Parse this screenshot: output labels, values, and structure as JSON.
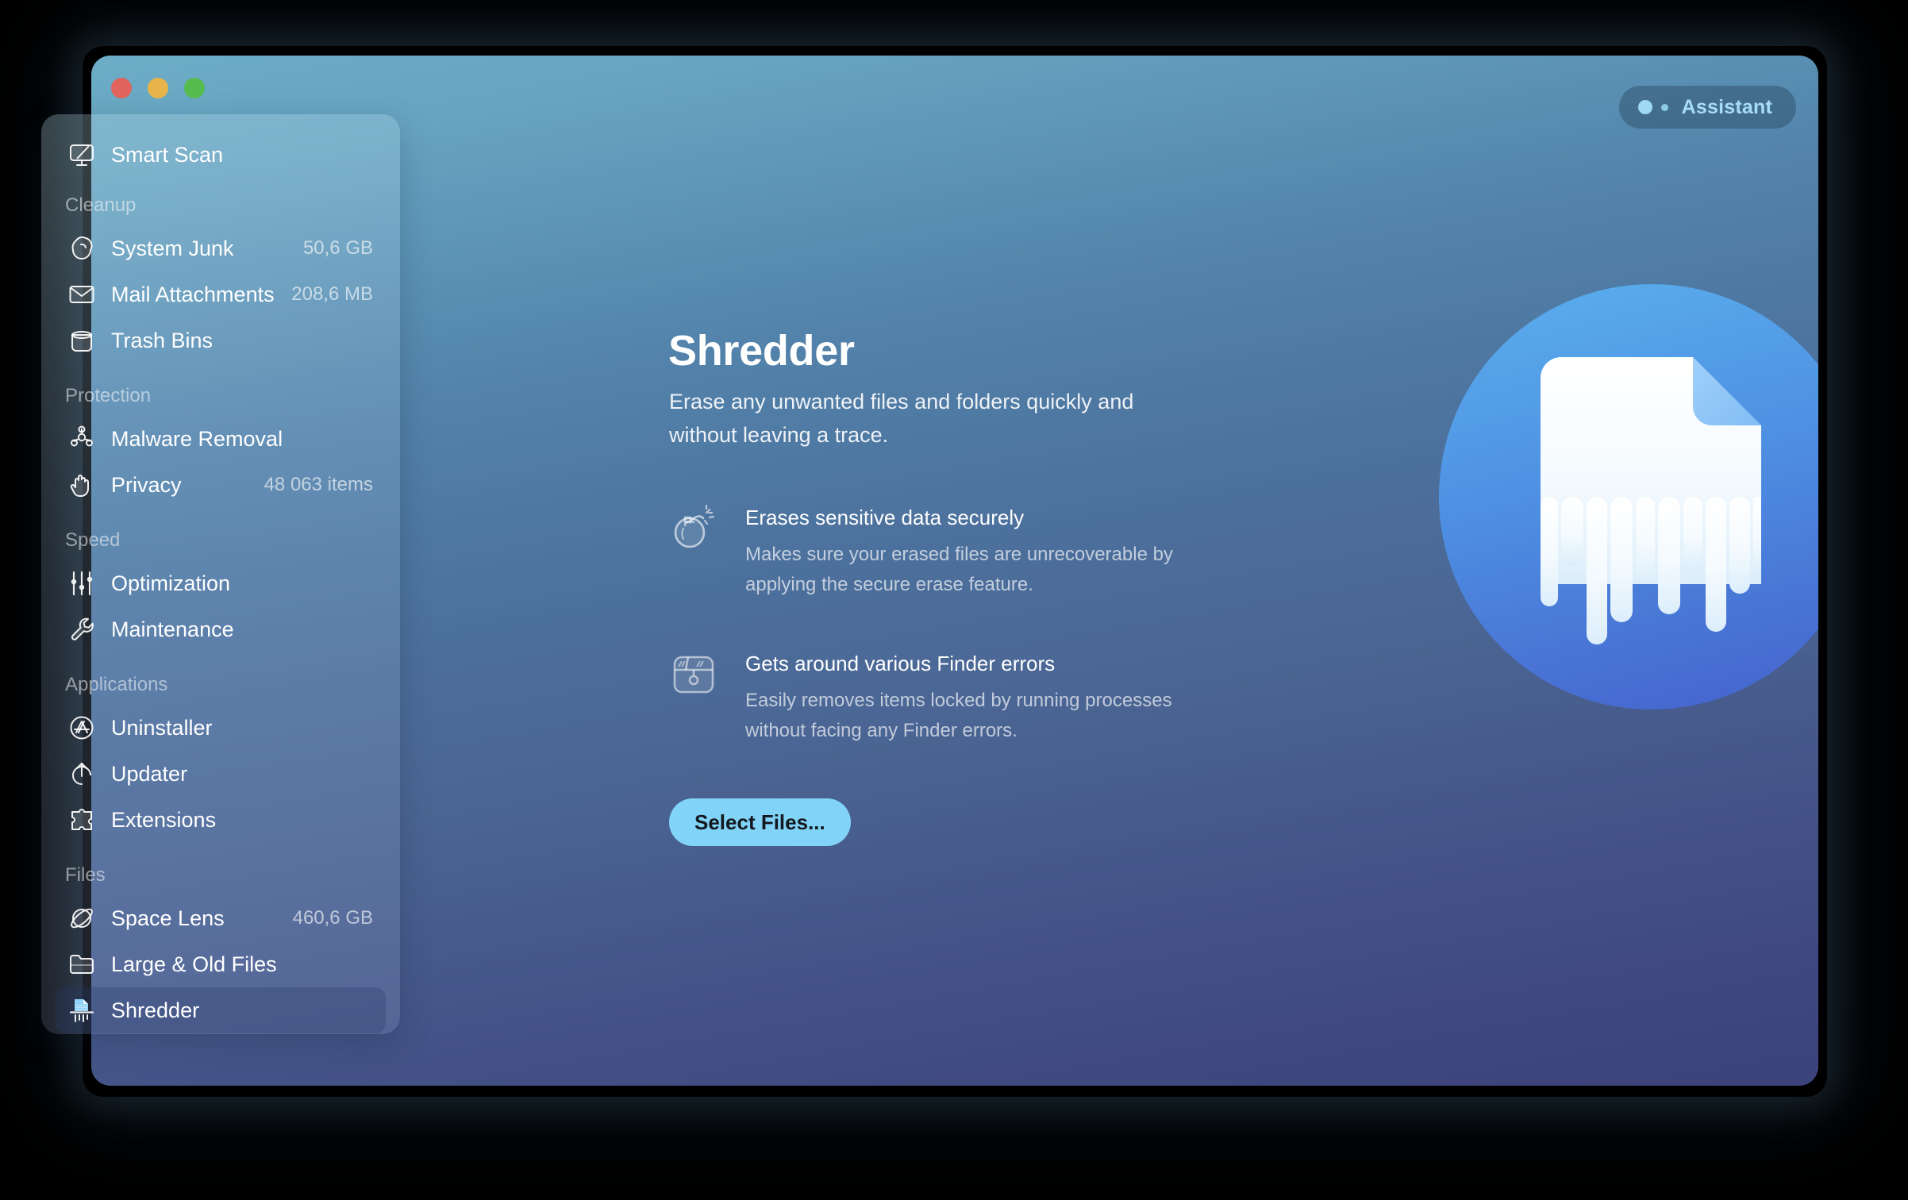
{
  "window": {
    "traffic_lights": [
      {
        "name": "close",
        "color": "#E0635C"
      },
      {
        "name": "minimize",
        "color": "#E8B44A"
      },
      {
        "name": "maximize",
        "color": "#56BC4E"
      }
    ]
  },
  "assistant": {
    "label": "Assistant"
  },
  "sidebar": {
    "top_items": [
      {
        "id": "smart-scan",
        "label": "Smart Scan",
        "icon": "display-scan-icon",
        "value": ""
      }
    ],
    "groups": [
      {
        "title": "Cleanup",
        "items": [
          {
            "id": "system-junk",
            "label": "System Junk",
            "icon": "broom-icon",
            "value": "50,6 GB"
          },
          {
            "id": "mail-attachments",
            "label": "Mail Attachments",
            "icon": "envelope-icon",
            "value": "208,6 MB"
          },
          {
            "id": "trash-bins",
            "label": "Trash Bins",
            "icon": "trash-bin-icon",
            "value": ""
          }
        ]
      },
      {
        "title": "Protection",
        "items": [
          {
            "id": "malware-removal",
            "label": "Malware Removal",
            "icon": "biohazard-icon",
            "value": ""
          },
          {
            "id": "privacy",
            "label": "Privacy",
            "icon": "hand-icon",
            "value": "48 063 items"
          }
        ]
      },
      {
        "title": "Speed",
        "items": [
          {
            "id": "optimization",
            "label": "Optimization",
            "icon": "sliders-icon",
            "value": ""
          },
          {
            "id": "maintenance",
            "label": "Maintenance",
            "icon": "wrench-icon",
            "value": ""
          }
        ]
      },
      {
        "title": "Applications",
        "items": [
          {
            "id": "uninstaller",
            "label": "Uninstaller",
            "icon": "appstore-icon",
            "value": ""
          },
          {
            "id": "updater",
            "label": "Updater",
            "icon": "up-arrow-icon",
            "value": ""
          },
          {
            "id": "extensions",
            "label": "Extensions",
            "icon": "puzzle-icon",
            "value": ""
          }
        ]
      },
      {
        "title": "Files",
        "items": [
          {
            "id": "space-lens",
            "label": "Space Lens",
            "icon": "planet-icon",
            "value": "460,6 GB"
          },
          {
            "id": "large-old-files",
            "label": "Large & Old Files",
            "icon": "folder-icon",
            "value": ""
          },
          {
            "id": "shredder",
            "label": "Shredder",
            "icon": "shredder-icon",
            "value": "",
            "selected": true
          }
        ]
      }
    ]
  },
  "main": {
    "title": "Shredder",
    "subtitle": "Erase any unwanted files and folders quickly and without leaving a trace.",
    "features": [
      {
        "icon": "bomb-icon",
        "title": "Erases sensitive data securely",
        "description": "Makes sure your erased files are unrecoverable by applying the secure erase feature."
      },
      {
        "icon": "locked-box-icon",
        "title": "Gets around various Finder errors",
        "description": "Easily removes items locked by running processes without facing any Finder errors."
      }
    ],
    "primary_action": "Select Files...",
    "illustration": "shredded-document-icon"
  },
  "colors": {
    "accent_button": "#81D4F7",
    "assistant_text": "#A6DCF5",
    "bg_top": "#6CADC6",
    "bg_bottom": "#3C427B",
    "hero_circle_top": "#55A7E8",
    "hero_circle_bottom": "#4A6FD4"
  }
}
